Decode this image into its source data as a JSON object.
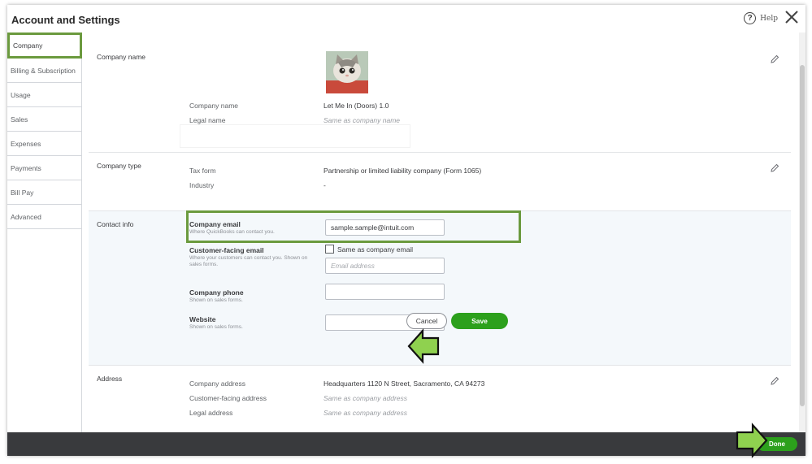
{
  "header": {
    "title": "Account and Settings",
    "help_label": "Help",
    "help_icon": "question-circle-icon",
    "close_icon": "close-icon"
  },
  "sidebar": {
    "items": [
      {
        "label": "Company",
        "active": true
      },
      {
        "label": "Billing & Subscription"
      },
      {
        "label": "Usage"
      },
      {
        "label": "Sales"
      },
      {
        "label": "Expenses"
      },
      {
        "label": "Payments"
      },
      {
        "label": "Bill Pay"
      },
      {
        "label": "Advanced"
      }
    ]
  },
  "company_name_section": {
    "title": "Company name",
    "rows": [
      {
        "label": "Company name",
        "value": "Let Me In (Doors) 1.0"
      },
      {
        "label": "Legal name",
        "value": "Same as company name"
      }
    ]
  },
  "company_type_section": {
    "title": "Company type",
    "rows": [
      {
        "label": "Tax form",
        "value": "Partnership or limited liability company (Form 1065)"
      },
      {
        "label": "Industry",
        "value": "-"
      }
    ]
  },
  "contact_info_section": {
    "title": "Contact info",
    "company_email": {
      "label": "Company email",
      "sub": "Where QuickBooks can contact you.",
      "value": "sample.sample@intuit.com"
    },
    "customer_facing_email": {
      "label": "Customer-facing email",
      "sub": "Where your customers can contact you. Shown on sales forms.",
      "checkbox_label": "Same as company email",
      "checked": false,
      "placeholder": "Email address"
    },
    "company_phone": {
      "label": "Company phone",
      "sub": "Shown on sales forms.",
      "value": ""
    },
    "website": {
      "label": "Website",
      "sub": "Shown on sales forms.",
      "value": ""
    },
    "cancel_label": "Cancel",
    "save_label": "Save"
  },
  "address_section": {
    "title": "Address",
    "rows": [
      {
        "label": "Company address",
        "value": "Headquarters 1120 N Street, Sacramento, CA 94273"
      },
      {
        "label": "Customer-facing address",
        "value": "Same as company address"
      },
      {
        "label": "Legal address",
        "value": "Same as company address"
      }
    ]
  },
  "footer": {
    "done_label": "Done"
  },
  "colors": {
    "accent_green": "#2ca01c",
    "highlight_green": "#6b9a3e",
    "arrow_green": "#8fd14f",
    "footer_bg": "#393a3d"
  }
}
